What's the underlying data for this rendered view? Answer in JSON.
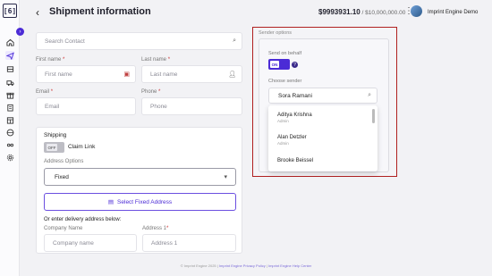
{
  "app": {
    "logo_text": "[6]"
  },
  "header": {
    "back_icon": "arrow-left-icon",
    "title": "Shipment information",
    "balance": "$9993931.10",
    "balance_limit": " / $10,000,000.00",
    "user_name": "Imprint Engine Demo"
  },
  "sidebar": {
    "icons": [
      "home-icon",
      "send-icon",
      "inventory-icon",
      "truck-icon",
      "gift-icon",
      "clipboard-icon",
      "store-icon",
      "globe-icon",
      "integrations-icon",
      "settings-icon"
    ]
  },
  "form": {
    "search_contact_placeholder": "Search Contact",
    "first_name_label": "First name",
    "first_name_placeholder": "First name",
    "last_name_label": "Last name",
    "last_name_placeholder": "Last name",
    "email_label": "Email",
    "email_placeholder": "Email",
    "phone_label": "Phone",
    "phone_placeholder": "Phone",
    "required_mark": "*"
  },
  "shipping": {
    "section_title": "Shipping",
    "claim_toggle_state": "OFF",
    "claim_link_label": "Claim Link",
    "address_options_label": "Address Options",
    "address_option_value": "Fixed",
    "select_fixed_address_button": "Select Fixed Address",
    "enter_below_text": "Or enter delivery address below:",
    "company_name_label": "Company Name",
    "company_name_placeholder": "Company name",
    "address1_label": "Address 1",
    "address1_placeholder": "Address 1"
  },
  "sender_options": {
    "title": "Sender options",
    "send_on_behalf_label": "Send on behalf",
    "toggle_state": "ON",
    "help_icon": "?",
    "choose_sender_label": "Choose sender",
    "sender_value": "Sora Ramani",
    "options": [
      {
        "name": "Aditya Krishna",
        "role": "Admin"
      },
      {
        "name": "Alan Detzler",
        "role": "Admin"
      },
      {
        "name": "Brooke Beissel",
        "role": ""
      }
    ]
  },
  "footer": {
    "text": "© Imprint Engine 2025",
    "privacy_link": "Imprint Engine Privacy Policy",
    "help_link": "Imprint Engine Help Center",
    "separator": " | "
  },
  "colors": {
    "accent": "#4b2bd6",
    "highlight_border": "#b02020",
    "background": "#f2f2f5"
  }
}
